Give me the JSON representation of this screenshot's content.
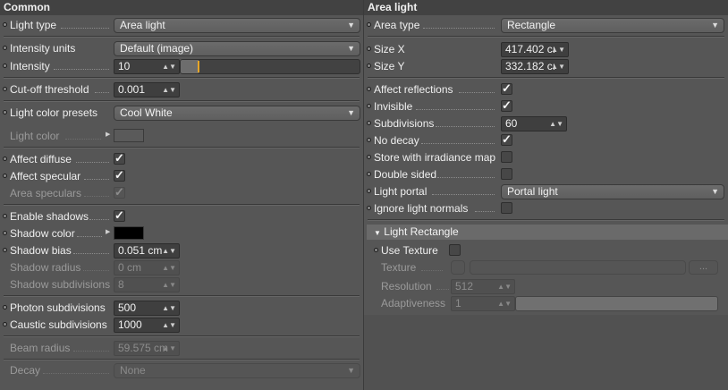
{
  "left": {
    "title": "Common",
    "light_type": {
      "label": "Light type",
      "value": "Area light"
    },
    "intensity_units": {
      "label": "Intensity units",
      "value": "Default (image)"
    },
    "intensity": {
      "label": "Intensity",
      "value": "10",
      "level": 0.1
    },
    "cutoff": {
      "label": "Cut-off threshold",
      "value": "0.001"
    },
    "presets": {
      "label": "Light color presets",
      "value": "Cool White"
    },
    "light_color": {
      "label": "Light color",
      "color": "#5a5a5a"
    },
    "affect_diffuse": {
      "label": "Affect diffuse",
      "checked": true
    },
    "affect_specular": {
      "label": "Affect specular",
      "checked": true
    },
    "area_speculars": {
      "label": "Area speculars",
      "checked": true
    },
    "enable_shadows": {
      "label": "Enable shadows",
      "checked": true
    },
    "shadow_color": {
      "label": "Shadow color",
      "color": "#000000"
    },
    "shadow_bias": {
      "label": "Shadow bias",
      "value": "0.051 cm"
    },
    "shadow_radius": {
      "label": "Shadow radius",
      "value": "0 cm"
    },
    "shadow_subdivisions": {
      "label": "Shadow subdivisions",
      "value": "8"
    },
    "photon_subdivisions": {
      "label": "Photon subdivisions",
      "value": "500"
    },
    "caustic_subdivisions": {
      "label": "Caustic subdivisions",
      "value": "1000"
    },
    "beam_radius": {
      "label": "Beam radius",
      "value": "59.575 cm"
    },
    "decay": {
      "label": "Decay",
      "value": "None"
    }
  },
  "right": {
    "title": "Area light",
    "area_type": {
      "label": "Area type",
      "value": "Rectangle"
    },
    "size_x": {
      "label": "Size X",
      "value": "417.402 cı"
    },
    "size_y": {
      "label": "Size Y",
      "value": "332.182 cı"
    },
    "affect_reflections": {
      "label": "Affect reflections",
      "checked": true
    },
    "invisible": {
      "label": "Invisible",
      "checked": true
    },
    "subdivisions": {
      "label": "Subdivisions",
      "value": "60"
    },
    "no_decay": {
      "label": "No decay",
      "checked": true
    },
    "store_irradiance": {
      "label": "Store with irradiance map",
      "checked": false
    },
    "double_sided": {
      "label": "Double sided",
      "checked": false
    },
    "light_portal": {
      "label": "Light portal",
      "value": "Portal light"
    },
    "ignore_normals": {
      "label": "Ignore light normals",
      "checked": false
    },
    "group": {
      "title": "Light Rectangle"
    },
    "use_texture": {
      "label": "Use Texture",
      "checked": false
    },
    "texture": {
      "label": "Texture",
      "button": "..."
    },
    "resolution": {
      "label": "Resolution",
      "value": "512"
    },
    "adaptiveness": {
      "label": "Adaptiveness",
      "value": "1",
      "level": 1.0
    }
  },
  "icons": {
    "dropdown": "chevron-down-icon",
    "spinner": "spinner-arrows-icon",
    "check": "checkmark-icon",
    "expand": "triangle-right-icon",
    "collapse": "triangle-down-icon"
  }
}
